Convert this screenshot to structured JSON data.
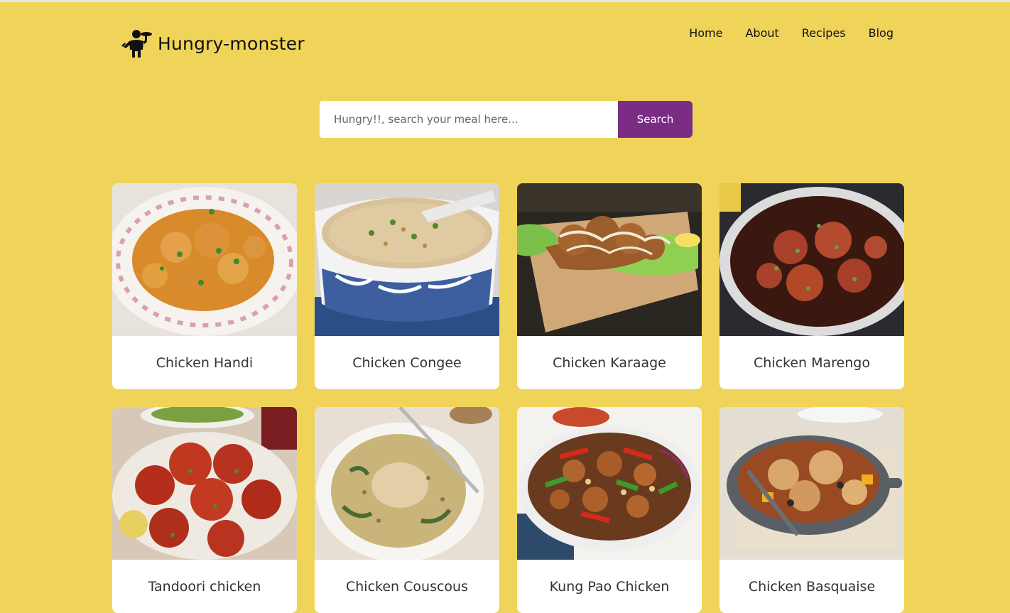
{
  "brand": {
    "name": "Hungry-monster",
    "logo_icon": "chef-holding-tray-icon"
  },
  "nav": {
    "items": [
      {
        "label": "Home"
      },
      {
        "label": "About"
      },
      {
        "label": "Recipes"
      },
      {
        "label": "Blog"
      }
    ]
  },
  "search": {
    "placeholder": "Hungry!!, search your meal here...",
    "value": "",
    "button_label": "Search"
  },
  "colors": {
    "background": "#f0d45a",
    "accent": "#7b2d86"
  },
  "meals": [
    {
      "name": "Chicken Handi",
      "image": "orange-curry-in-floral-plate"
    },
    {
      "name": "Chicken Congee",
      "image": "rice-porridge-in-blue-bowl"
    },
    {
      "name": "Chicken Karaage",
      "image": "fried-chicken-on-lettuce-board"
    },
    {
      "name": "Chicken Marengo",
      "image": "stew-in-white-pan"
    },
    {
      "name": "Tandoori chicken",
      "image": "red-roasted-chicken-pieces"
    },
    {
      "name": "Chicken Couscous",
      "image": "couscous-bowl-with-fork"
    },
    {
      "name": "Kung Pao Chicken",
      "image": "stir-fry-with-peppers"
    },
    {
      "name": "Chicken Basquaise",
      "image": "chicken-casserole-pan"
    }
  ]
}
